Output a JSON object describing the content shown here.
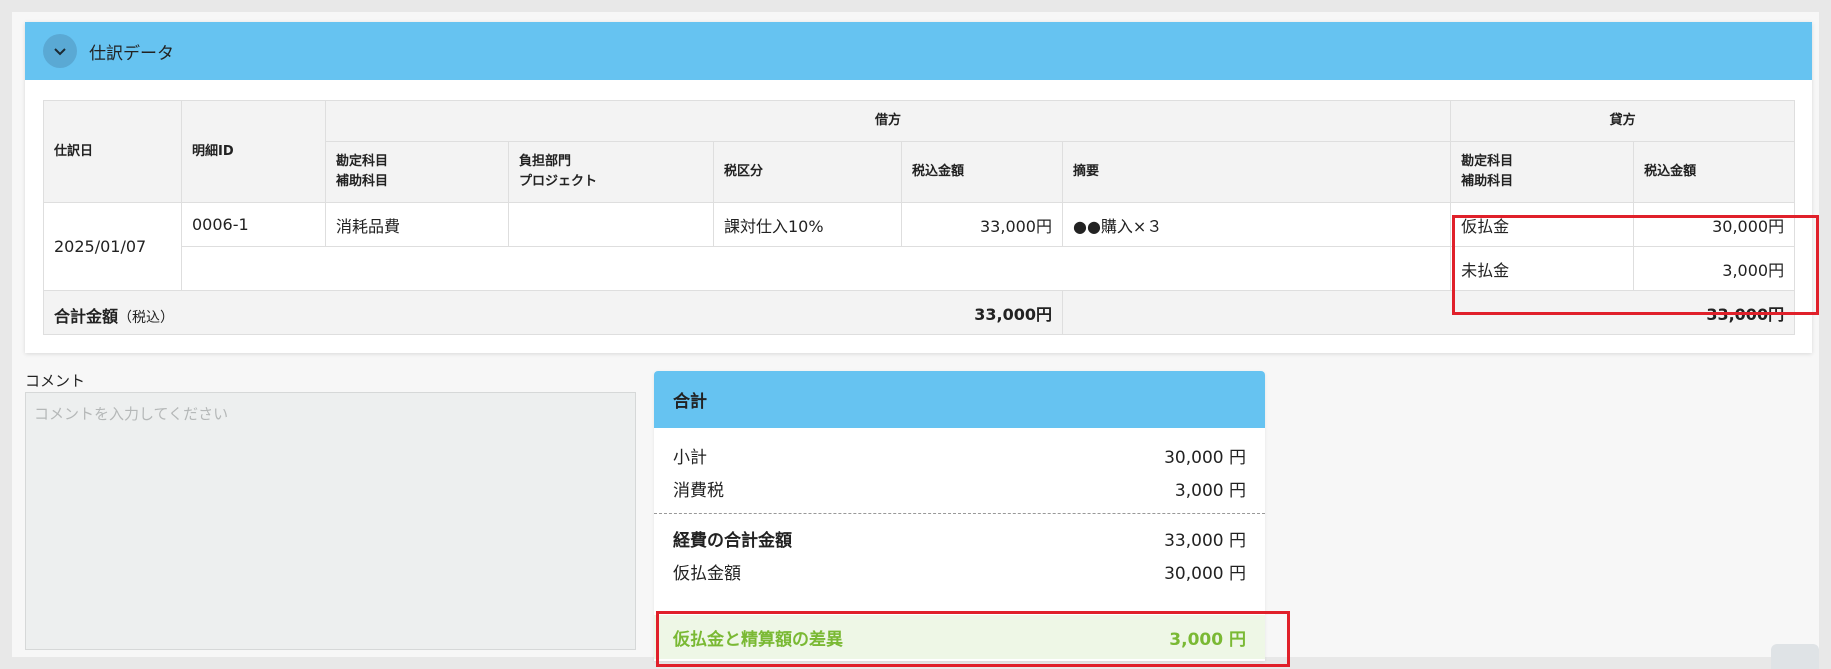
{
  "journal": {
    "title": "仕訳データ",
    "headers": {
      "date": "仕訳日",
      "line_id": "明細ID",
      "debit_group": "借方",
      "credit_group": "貸方",
      "debit_account": "勘定科目",
      "debit_sub_account": "補助科目",
      "dept": "負担部門",
      "project": "プロジェクト",
      "tax_class": "税区分",
      "debit_amount": "税込金額",
      "memo": "摘要",
      "credit_account": "勘定科目",
      "credit_sub_account": "補助科目",
      "credit_amount": "税込金額"
    },
    "row": {
      "date": "2025/01/07",
      "line_id": "0006-1",
      "debit_account": "消耗品費",
      "dept": "",
      "tax_class": "課対仕入10%",
      "debit_amount": "33,000円",
      "memo": "●●購入×３"
    },
    "credits": [
      {
        "account": "仮払金",
        "amount": "30,000円"
      },
      {
        "account": "未払金",
        "amount": "3,000円"
      }
    ],
    "total": {
      "label": "合計金額",
      "label_note": "（税込）",
      "debit": "33,000円",
      "credit": "33,000円"
    }
  },
  "comment": {
    "label": "コメント",
    "placeholder": "コメントを入力してください"
  },
  "totals": {
    "title": "合計",
    "rows": [
      {
        "label": "小計",
        "value": "30,000 円"
      },
      {
        "label": "消費税",
        "value": "3,000 円"
      }
    ],
    "rows2": [
      {
        "label": "経費の合計金額",
        "value": "33,000 円"
      },
      {
        "label": "仮払金額",
        "value": "30,000 円"
      }
    ],
    "difference": {
      "label": "仮払金と精算額の差異",
      "value": "3,000 円"
    }
  },
  "colors": {
    "header_blue": "#66c3f1",
    "highlight_red": "#e0202a",
    "diff_green": "#7ab934"
  }
}
